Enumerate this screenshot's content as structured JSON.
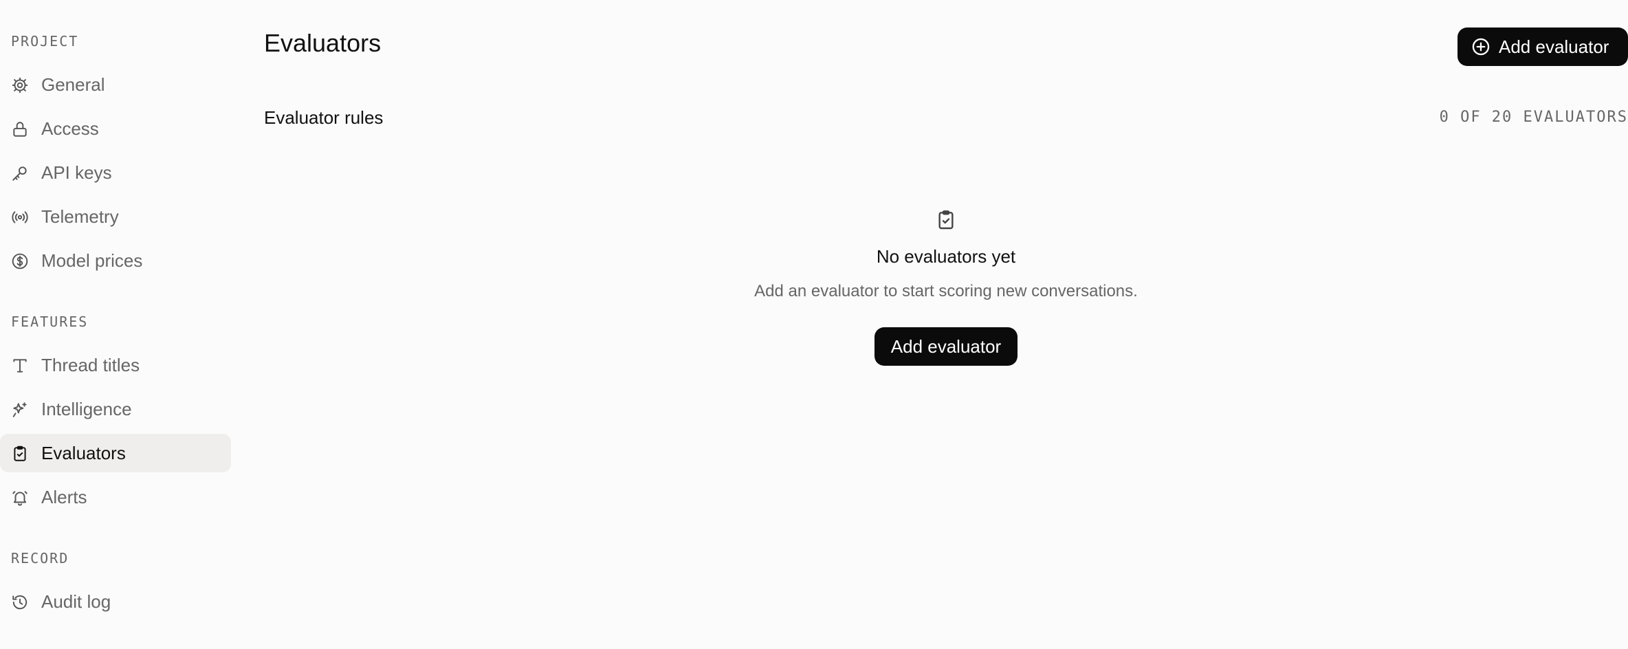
{
  "sidebar": {
    "sections": [
      {
        "label": "PROJECT",
        "items": [
          {
            "label": "General",
            "icon": "gear-icon"
          },
          {
            "label": "Access",
            "icon": "lock-icon"
          },
          {
            "label": "API keys",
            "icon": "key-icon"
          },
          {
            "label": "Telemetry",
            "icon": "broadcast-icon"
          },
          {
            "label": "Model prices",
            "icon": "dollar-circle-icon"
          }
        ]
      },
      {
        "label": "FEATURES",
        "items": [
          {
            "label": "Thread titles",
            "icon": "type-icon"
          },
          {
            "label": "Intelligence",
            "icon": "sparkles-icon"
          },
          {
            "label": "Evaluators",
            "icon": "clipboard-check-icon",
            "active": true
          },
          {
            "label": "Alerts",
            "icon": "bell-icon"
          }
        ]
      },
      {
        "label": "RECORD",
        "items": [
          {
            "label": "Audit log",
            "icon": "history-icon"
          }
        ]
      }
    ]
  },
  "header": {
    "title": "Evaluators",
    "add_button_label": "Add evaluator",
    "add_button_icon": "plus-circle-icon"
  },
  "rules": {
    "title": "Evaluator rules",
    "count_label": "0 OF 20 EVALUATORS"
  },
  "empty_state": {
    "icon": "clipboard-check-icon",
    "title": "No evaluators yet",
    "description": "Add an evaluator to start scoring new conversations.",
    "button_label": "Add evaluator"
  },
  "colors": {
    "background": "#fbfbfb",
    "active_item_bg": "#efeeec",
    "button_bg": "#0b0b0b",
    "muted_text": "#666666"
  }
}
